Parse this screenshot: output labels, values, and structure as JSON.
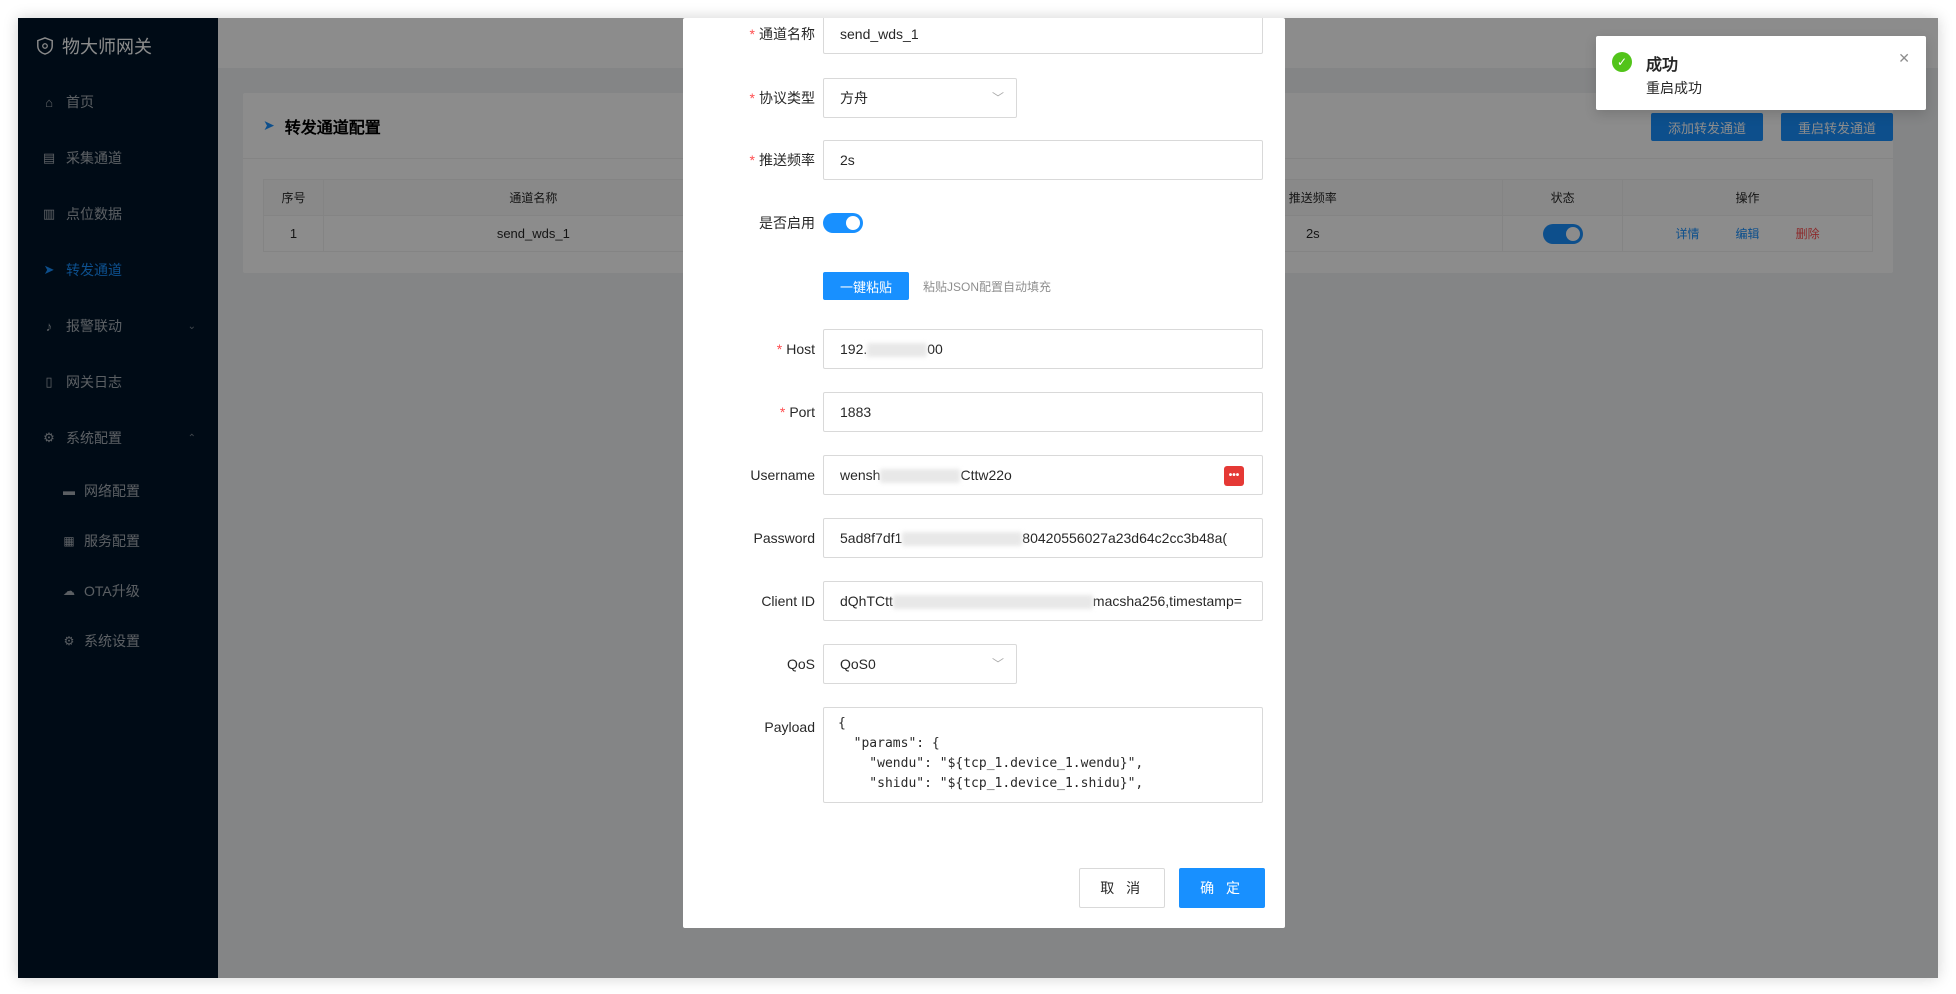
{
  "app": {
    "title": "物大师网关"
  },
  "sidebar": {
    "items": [
      {
        "label": "首页",
        "icon": "home-icon"
      },
      {
        "label": "采集通道",
        "icon": "collect-icon"
      },
      {
        "label": "点位数据",
        "icon": "bar-chart-icon"
      },
      {
        "label": "转发通道",
        "icon": "send-icon"
      },
      {
        "label": "报警联动",
        "icon": "bell-icon"
      },
      {
        "label": "网关日志",
        "icon": "file-icon"
      },
      {
        "label": "系统配置",
        "icon": "gear-icon"
      }
    ],
    "sub_items": [
      {
        "label": "网络配置",
        "icon": "monitor-icon"
      },
      {
        "label": "服务配置",
        "icon": "server-icon"
      },
      {
        "label": "OTA升级",
        "icon": "cloud-icon"
      },
      {
        "label": "系统设置",
        "icon": "settings-icon"
      }
    ]
  },
  "card": {
    "title": "转发通道配置",
    "add_button": "添加转发通道",
    "restart_button": "重启转发通道",
    "table": {
      "headers": [
        "序号",
        "通道名称",
        "推送频率",
        "状态",
        "操作"
      ],
      "rows": [
        {
          "index": "1",
          "name": "send_wds_1",
          "frequency": "2s",
          "status_on": true
        }
      ],
      "actions": {
        "detail": "详情",
        "edit": "编辑",
        "delete": "删除"
      }
    }
  },
  "form": {
    "channel_name": {
      "label": "通道名称",
      "value": "send_wds_1"
    },
    "protocol": {
      "label": "协议类型",
      "value": "方舟"
    },
    "frequency": {
      "label": "推送频率",
      "value": "2s"
    },
    "enabled": {
      "label": "是否启用",
      "on": true
    },
    "paste": {
      "button": "一键粘贴",
      "hint": "粘贴JSON配置自动填充"
    },
    "host": {
      "label": "Host",
      "prefix": "192.",
      "suffix": "00"
    },
    "port": {
      "label": "Port",
      "value": "1883"
    },
    "username": {
      "label": "Username",
      "prefix": "wensh",
      "suffix": "Cttw22o"
    },
    "password": {
      "label": "Password",
      "prefix": "5ad8f7df1",
      "suffix": "80420556027a23d64c2cc3b48a("
    },
    "client_id": {
      "label": "Client ID",
      "prefix": "dQhTCtt",
      "suffix": "macsha256,timestamp="
    },
    "qos": {
      "label": "QoS",
      "value": "QoS0"
    },
    "payload": {
      "label": "Payload",
      "value": "{\n  \"params\": {\n    \"wendu\": \"${tcp_1.device_1.wendu}\",\n    \"shidu\": \"${tcp_1.device_1.shidu}\",\n"
    },
    "cancel": "取 消",
    "confirm": "确 定"
  },
  "notification": {
    "title": "成功",
    "message": "重启成功"
  },
  "colors": {
    "primary": "#1890ff",
    "sidebar": "#001529",
    "success": "#52c41a",
    "danger": "#ff4d4f"
  }
}
